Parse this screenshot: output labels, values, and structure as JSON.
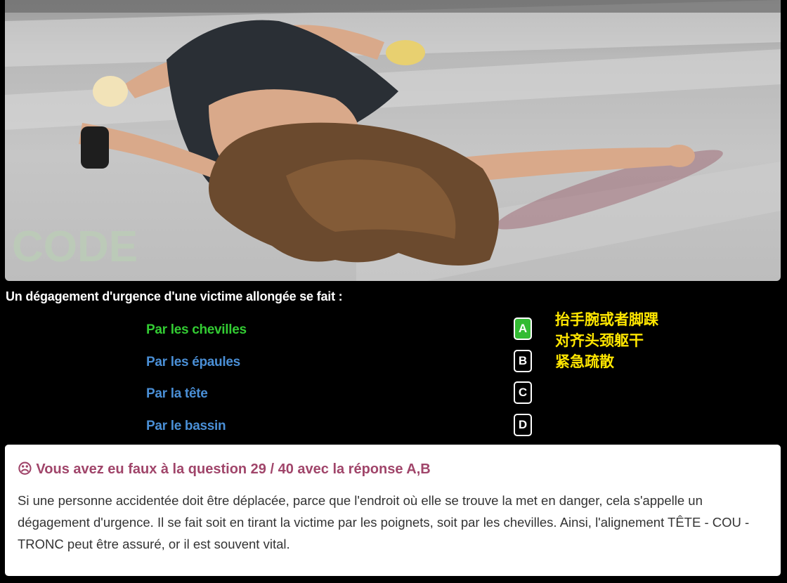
{
  "question": {
    "text": "Un dégagement d'urgence d'une victime allongée se fait :"
  },
  "answers": [
    {
      "letter": "A",
      "label": "Par les chevilles",
      "correct": true
    },
    {
      "letter": "B",
      "label": "Par les épaules",
      "correct": false
    },
    {
      "letter": "C",
      "label": "Par la tête",
      "correct": false
    },
    {
      "letter": "D",
      "label": "Par le bassin",
      "correct": false
    }
  ],
  "note_lines": [
    "抬手腕或者脚踝",
    "对齐头颈躯干",
    "紧急疏散"
  ],
  "result": {
    "icon": "sad-face-icon",
    "title": "☹ Vous avez eu faux à la question 29 / 40 avec la réponse A,B",
    "explanation": "Si une personne accidentée doit être déplacée, parce que l'endroit où elle se trouve la met en danger, cela s'appelle un dégagement d'urgence. Il se fait soit en tirant la victime par les poignets, soit par les chevilles. Ainsi, l'alignement TÊTE - COU - TRONC peut être assuré, or il est souvent vital."
  },
  "photo": {
    "watermark": "CODE"
  },
  "colors": {
    "correct": "#33cc33",
    "answer": "#4a8fd6",
    "note": "#ffe600",
    "result_title": "#a0456a"
  }
}
